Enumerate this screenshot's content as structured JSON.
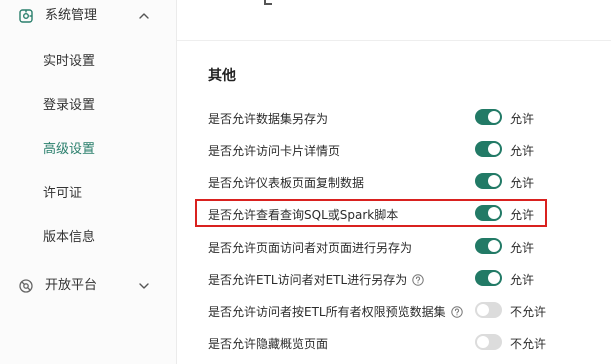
{
  "colors": {
    "accent": "#2a7f6c",
    "toggle_on": "#227a66",
    "toggle_off": "#dcdcdc",
    "highlight": "#d9211f"
  },
  "sidebar": {
    "groups": [
      {
        "label": "系统管理",
        "icon": "gear-settings-icon",
        "chevron": "chevron-up-icon",
        "expanded": true
      },
      {
        "label": "开放平台",
        "icon": "open-platform-icon",
        "chevron": "chevron-down-icon",
        "expanded": false
      }
    ],
    "items": [
      {
        "label": "实时设置",
        "active": false
      },
      {
        "label": "登录设置",
        "active": false
      },
      {
        "label": "高级设置",
        "active": true
      },
      {
        "label": "许可证",
        "active": false
      },
      {
        "label": "版本信息",
        "active": false
      }
    ]
  },
  "main": {
    "section_title": "其他",
    "settings": [
      {
        "label": "是否允许数据集另存为",
        "enabled": true,
        "state": "允许",
        "help": false
      },
      {
        "label": "是否允许访问卡片详情页",
        "enabled": true,
        "state": "允许",
        "help": false
      },
      {
        "label": "是否允许仪表板页面复制数据",
        "enabled": true,
        "state": "允许",
        "help": false
      },
      {
        "label": "是否允许查看查询SQL或Spark脚本",
        "enabled": true,
        "state": "允许",
        "help": false,
        "highlighted": true
      },
      {
        "label": "是否允许页面访问者对页面进行另存为",
        "enabled": true,
        "state": "允许",
        "help": false
      },
      {
        "label": "是否允许ETL访问者对ETL进行另存为",
        "enabled": true,
        "state": "允许",
        "help": true
      },
      {
        "label": "是否允许访问者按ETL所有者权限预览数据集",
        "enabled": false,
        "state": "不允许",
        "help": true
      },
      {
        "label": "是否允许隐藏概览页面",
        "enabled": false,
        "state": "不允许",
        "help": false
      }
    ]
  }
}
